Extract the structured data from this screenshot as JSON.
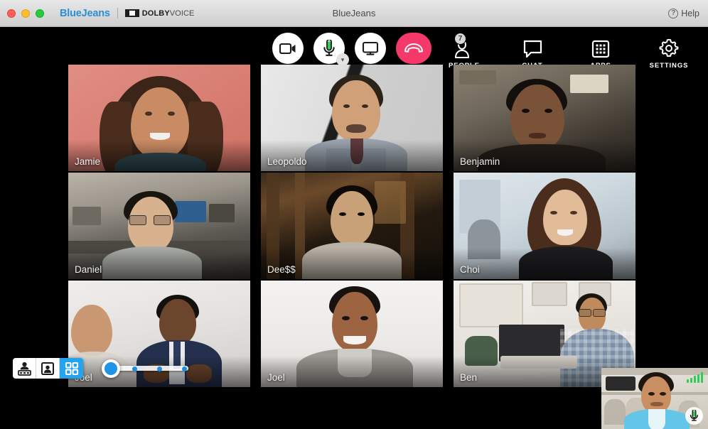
{
  "window": {
    "title": "BlueJeans",
    "app_name": "BlueJeans",
    "partner_brand_bold": "DOLBY",
    "partner_brand_light": "VOICE",
    "help_label": "Help",
    "traffic_lights": [
      "close",
      "minimize",
      "maximize"
    ]
  },
  "toolbar": {
    "center_controls": [
      {
        "name": "camera",
        "icon": "video-camera-icon",
        "state": "on",
        "label": ""
      },
      {
        "name": "microphone",
        "icon": "microphone-icon",
        "state": "on",
        "label": "",
        "has_dropdown": true
      },
      {
        "name": "screen-share",
        "icon": "monitor-icon",
        "state": "off",
        "label": ""
      },
      {
        "name": "hang-up",
        "icon": "phone-hangup-icon",
        "state": "active",
        "label": ""
      }
    ],
    "right_controls": [
      {
        "name": "people",
        "label": "PEOPLE",
        "icon": "person-icon",
        "badge": "7"
      },
      {
        "name": "chat",
        "label": "CHAT",
        "icon": "chat-bubble-icon",
        "badge": ""
      },
      {
        "name": "apps",
        "label": "APPS",
        "icon": "grid-apps-icon",
        "badge": ""
      },
      {
        "name": "settings",
        "label": "SETTINGS",
        "icon": "gear-icon",
        "badge": ""
      }
    ]
  },
  "grid": {
    "columns": 3,
    "rows": 3,
    "participants": [
      {
        "name": "Jamie",
        "scene": "s-jamie"
      },
      {
        "name": "Leopoldo",
        "scene": "s-leo"
      },
      {
        "name": "Benjamin",
        "scene": "s-ben"
      },
      {
        "name": "Daniel",
        "scene": "s-dan"
      },
      {
        "name": "Dee$$",
        "scene": "s-dee"
      },
      {
        "name": "Choi",
        "scene": "s-choi"
      },
      {
        "name": "Joel",
        "scene": "s-joel1"
      },
      {
        "name": "Joel",
        "scene": "s-joel2"
      },
      {
        "name": "Ben",
        "scene": "s-benw"
      }
    ]
  },
  "layout_widget": {
    "buttons": [
      {
        "name": "speaker-view",
        "icon": "person-with-filmstrip-icon",
        "active": false
      },
      {
        "name": "single-view",
        "icon": "single-person-frame-icon",
        "active": false
      },
      {
        "name": "grid-view",
        "icon": "four-squares-grid-icon",
        "active": true
      }
    ],
    "slider": {
      "name": "tile-size-slider",
      "value": 0,
      "min": 0,
      "max": 3,
      "stops": 3
    }
  },
  "self_view": {
    "name": "self-view-pip",
    "signal_strength_bars": 5,
    "signal_color": "#2ecc5a",
    "mic": {
      "icon": "microphone-icon",
      "state": "on"
    }
  },
  "colors": {
    "accent_blue": "#24a3ee",
    "brand_blue": "#2a8fd4",
    "hangup_red": "#f5396b",
    "mic_green": "#2ecc5a",
    "stage_black": "#000000",
    "titlebar_grey": "#d9d9d9"
  }
}
